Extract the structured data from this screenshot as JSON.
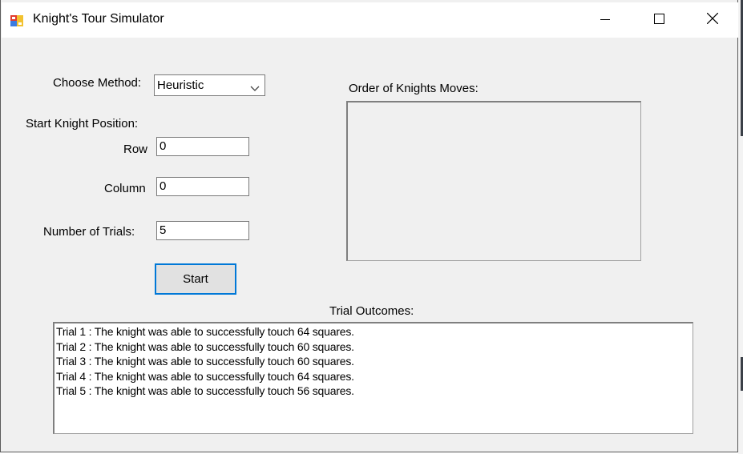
{
  "window": {
    "title": "Knight's Tour Simulator",
    "minimize_icon": "minimize-icon",
    "maximize_icon": "maximize-icon",
    "close_icon": "close-icon"
  },
  "form": {
    "method_label": "Choose Method:",
    "method_value": "Heuristic",
    "start_position_label": "Start Knight Position:",
    "row_label": "Row",
    "row_value": "0",
    "column_label": "Column",
    "column_value": "0",
    "trials_label": "Number of Trials:",
    "trials_value": "5",
    "start_button": "Start"
  },
  "moves": {
    "label": "Order of Knights Moves:"
  },
  "outcomes": {
    "label": "Trial Outcomes:",
    "lines": [
      "Trial 1 : The knight was able to successfully touch 64 squares.",
      "Trial 2 : The knight was able to successfully touch 60 squares.",
      "Trial 3 : The knight was able to successfully touch 60 squares.",
      "Trial 4 : The knight was able to successfully touch 64 squares.",
      "Trial 5 : The knight was able to successfully touch 56 squares."
    ]
  }
}
